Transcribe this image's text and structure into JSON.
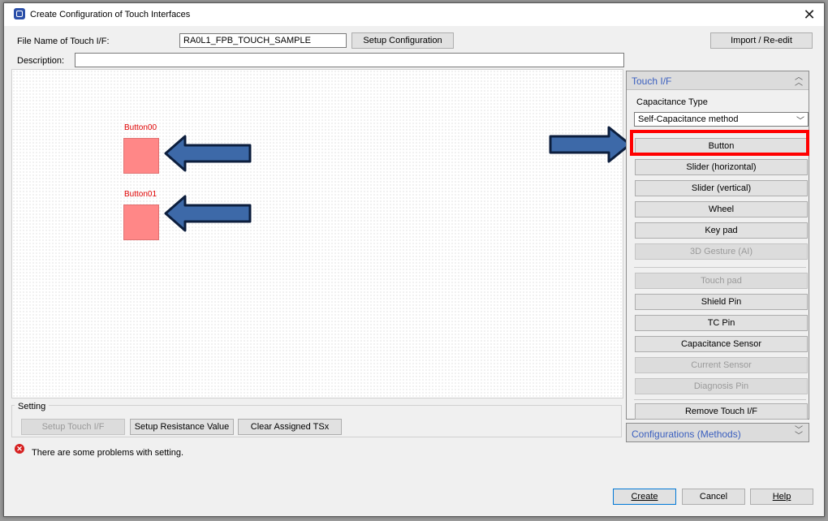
{
  "window": {
    "title": "Create Configuration of Touch Interfaces"
  },
  "form": {
    "file_name_label": "File Name of Touch I/F:",
    "file_name_value": "RA0L1_FPB_TOUCH_SAMPLE",
    "setup_configuration_label": "Setup Configuration",
    "import_reedit_label": "Import / Re-edit",
    "description_label": "Description:",
    "description_value": ""
  },
  "canvas": {
    "buttons": [
      {
        "label": "Button00"
      },
      {
        "label": "Button01"
      }
    ],
    "colors": {
      "touch_button": "#ff8787",
      "label": "#e00000",
      "arrow": "#3d69a8"
    }
  },
  "setting": {
    "title": "Setting",
    "buttons": [
      {
        "label": "Setup Touch I/F",
        "enabled": false
      },
      {
        "label": "Setup Resistance Value",
        "enabled": true
      },
      {
        "label": "Clear Assigned TSx",
        "enabled": true
      }
    ]
  },
  "status": {
    "message": "There are some problems with setting."
  },
  "touch_if_panel": {
    "title": "Touch I/F",
    "capacitance_type_label": "Capacitance Type",
    "capacitance_type_value": "Self-Capacitance method",
    "items": [
      {
        "label": "Button",
        "enabled": true
      },
      {
        "label": "Slider (horizontal)",
        "enabled": true
      },
      {
        "label": "Slider (vertical)",
        "enabled": true
      },
      {
        "label": "Wheel",
        "enabled": true
      },
      {
        "label": "Key pad",
        "enabled": true
      },
      {
        "label": "3D Gesture (AI)",
        "enabled": false
      },
      {
        "label": "Touch pad",
        "enabled": false
      },
      {
        "label": "Shield Pin",
        "enabled": true
      },
      {
        "label": "TC Pin",
        "enabled": true
      },
      {
        "label": "Capacitance Sensor",
        "enabled": true
      },
      {
        "label": "Current Sensor",
        "enabled": false
      },
      {
        "label": "Diagnosis Pin",
        "enabled": false
      },
      {
        "label": "Remove Touch I/F",
        "enabled": true
      }
    ]
  },
  "configurations_panel": {
    "title": "Configurations (Methods)"
  },
  "dialog_buttons": {
    "create_label": "Create",
    "cancel_label": "Cancel",
    "help_label": "Help"
  },
  "icons": {
    "app": "app-icon",
    "close": "close-icon",
    "error": "error-icon",
    "collapse": "double-chevron-up-icon",
    "expand": "double-chevron-down-icon",
    "dropdown": "chevron-down-icon",
    "arrow_left": "arrow-left-icon",
    "arrow_right": "arrow-right-icon"
  },
  "annotation": {
    "highlight_color": "#ff0000"
  }
}
